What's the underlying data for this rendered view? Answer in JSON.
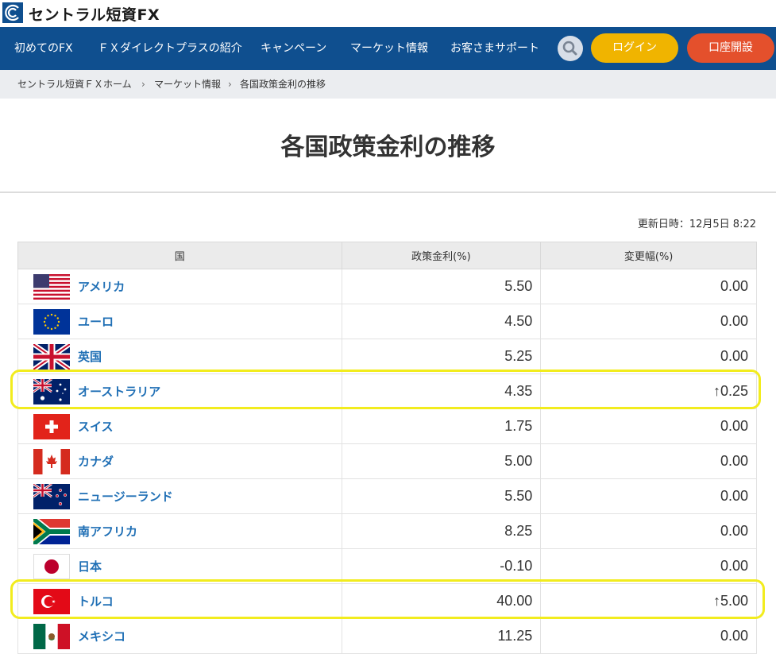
{
  "brand": {
    "name": "セントラル短資FX"
  },
  "nav": {
    "items": [
      "初めてのFX",
      "ＦＸダイレクトプラスの紹介",
      "キャンペーン",
      "マーケット情報",
      "お客さまサポート"
    ],
    "login_label": "ログイン",
    "open_account_label": "口座開設"
  },
  "breadcrumb": [
    "セントラル短資ＦＸホーム",
    "マーケット情報",
    "各国政策金利の推移"
  ],
  "page": {
    "title": "各国政策金利の推移",
    "updated": "更新日時：12月5日 8:22"
  },
  "table": {
    "headers": [
      "国",
      "政策金利(%)",
      "変更幅(%)"
    ],
    "rows": [
      {
        "country": "アメリカ",
        "flag": "us-flag",
        "rate": "5.50",
        "change": "0.00",
        "up": false
      },
      {
        "country": "ユーロ",
        "flag": "eu-flag",
        "rate": "4.50",
        "change": "0.00",
        "up": false
      },
      {
        "country": "英国",
        "flag": "uk-flag",
        "rate": "5.25",
        "change": "0.00",
        "up": false
      },
      {
        "country": "オーストラリア",
        "flag": "au-flag",
        "rate": "4.35",
        "change": "↑0.25",
        "up": true
      },
      {
        "country": "スイス",
        "flag": "ch-flag",
        "rate": "1.75",
        "change": "0.00",
        "up": false
      },
      {
        "country": "カナダ",
        "flag": "ca-flag",
        "rate": "5.00",
        "change": "0.00",
        "up": false
      },
      {
        "country": "ニュージーランド",
        "flag": "nz-flag",
        "rate": "5.50",
        "change": "0.00",
        "up": false
      },
      {
        "country": "南アフリカ",
        "flag": "za-flag",
        "rate": "8.25",
        "change": "0.00",
        "up": false
      },
      {
        "country": "日本",
        "flag": "jp-flag",
        "rate": "-0.10",
        "change": "0.00",
        "up": false
      },
      {
        "country": "トルコ",
        "flag": "tr-flag",
        "rate": "40.00",
        "change": "↑5.00",
        "up": true
      },
      {
        "country": "メキシコ",
        "flag": "mx-flag",
        "rate": "11.25",
        "change": "0.00",
        "up": false
      }
    ]
  },
  "colors": {
    "nav_bg": "#0f4f8f",
    "login": "#f0b400",
    "open_account": "#e4502c",
    "link": "#1f6fb5",
    "up": "#d9331f",
    "highlight": "#f2ec1e"
  }
}
